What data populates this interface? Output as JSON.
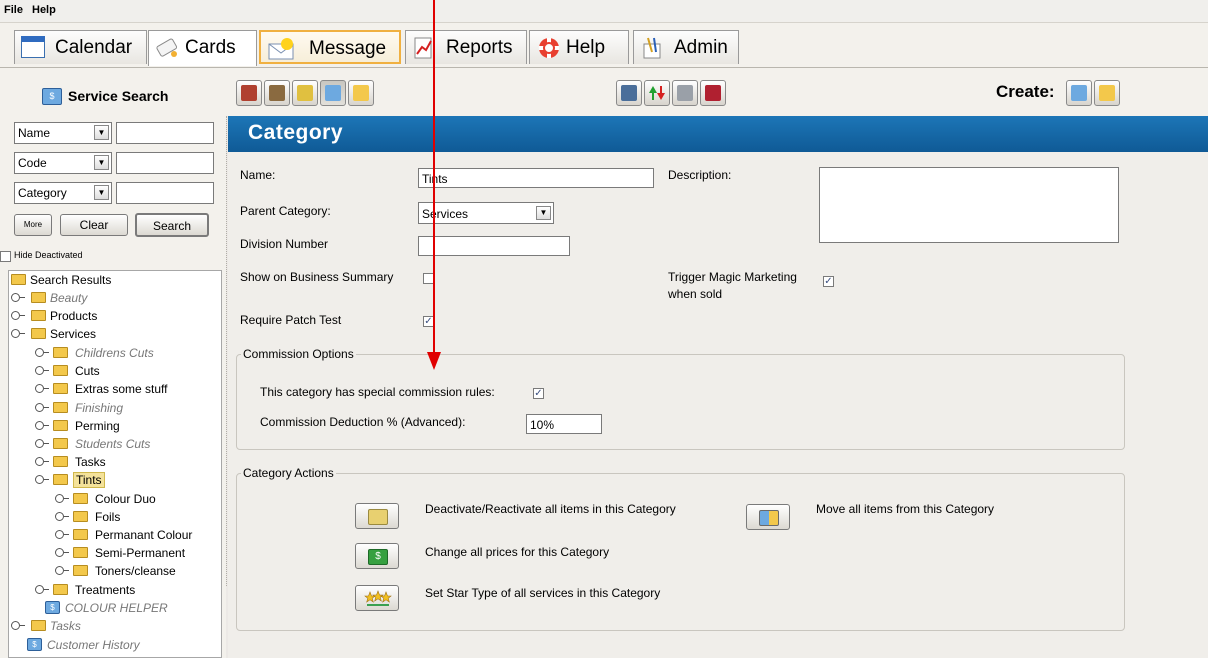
{
  "menu": {
    "file": "File",
    "help": "Help"
  },
  "tabs": [
    {
      "label": "Calendar",
      "icon": "calendar-icon"
    },
    {
      "label": "Cards",
      "icon": "cards-icon"
    },
    {
      "label": "Message",
      "icon": "message-icon"
    },
    {
      "label": "Reports",
      "icon": "reports-icon"
    },
    {
      "label": "Help",
      "icon": "lifebuoy-icon"
    },
    {
      "label": "Admin",
      "icon": "admin-icon"
    }
  ],
  "toolbar": {
    "create_label": "Create:"
  },
  "search": {
    "title": "Service Search",
    "fields": [
      {
        "type": "Name",
        "value": ""
      },
      {
        "type": "Code",
        "value": ""
      },
      {
        "type": "Category",
        "value": ""
      }
    ],
    "more_label": "More",
    "clear_label": "Clear",
    "search_label": "Search",
    "hide_deactivated_label": "Hide Deactivated"
  },
  "tree": {
    "root": "Search Results",
    "items": [
      {
        "label": "Beauty",
        "deactivated": true
      },
      {
        "label": "Products",
        "deactivated": false
      },
      {
        "label": "Services",
        "deactivated": false
      },
      {
        "label": "Childrens Cuts",
        "deactivated": true
      },
      {
        "label": "Cuts",
        "deactivated": false
      },
      {
        "label": "Extras some stuff",
        "deactivated": false
      },
      {
        "label": "Finishing",
        "deactivated": true
      },
      {
        "label": "Perming",
        "deactivated": false
      },
      {
        "label": "Students Cuts",
        "deactivated": true
      },
      {
        "label": "Tasks",
        "deactivated": false
      },
      {
        "label": "Tints",
        "deactivated": false,
        "selected": true
      },
      {
        "label": "Colour Duo",
        "deactivated": false
      },
      {
        "label": "Foils",
        "deactivated": false
      },
      {
        "label": "Permanant Colour",
        "deactivated": false
      },
      {
        "label": "Semi-Permanent",
        "deactivated": false
      },
      {
        "label": "Toners/cleanse",
        "deactivated": false
      },
      {
        "label": "Treatments",
        "deactivated": false
      },
      {
        "label": "COLOUR HELPER",
        "deactivated": true
      },
      {
        "label": "Tasks",
        "deactivated": true
      },
      {
        "label": "Customer History",
        "deactivated": true
      }
    ]
  },
  "category": {
    "title": "Category",
    "name_label": "Name:",
    "name_value": "Tints",
    "description_label": "Description:",
    "description_value": "",
    "parent_label": "Parent Category:",
    "parent_value": "Services",
    "division_label": "Division Number",
    "division_value": "",
    "show_summary_label": "Show on Business Summary",
    "show_summary_checked": false,
    "trigger_label_1": "Trigger Magic Marketing",
    "trigger_label_2": "when sold",
    "trigger_checked": true,
    "patch_label": "Require Patch Test",
    "patch_checked": true,
    "commission": {
      "title": "Commission Options",
      "special_label": "This category has special commission rules:",
      "special_checked": true,
      "deduction_label": "Commission Deduction % (Advanced):",
      "deduction_value": "10%"
    },
    "actions": {
      "title": "Category Actions",
      "deactivate_label": "Deactivate/Reactivate all items in this Category",
      "move_label": "Move all items from this Category",
      "prices_label": "Change all prices for this Category",
      "star_label": "Set Star Type of all services in this Category"
    }
  },
  "colors": {
    "banner": "#1465a8",
    "accent_arrow": "#e00000",
    "folder": "#f3c84b"
  }
}
